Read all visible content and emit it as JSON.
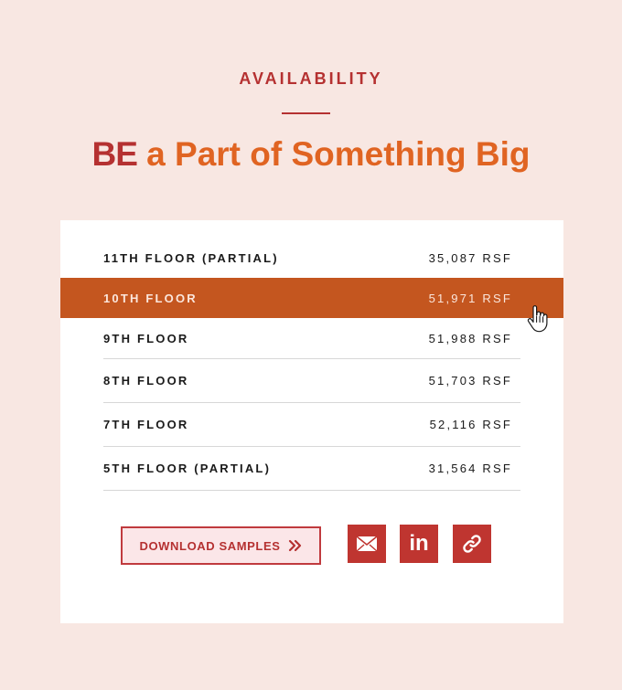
{
  "section": {
    "eyebrow": "AVAILABILITY",
    "headline_strong": "BE",
    "headline_rest": " a Part of Something Big"
  },
  "floors": [
    {
      "name": "11TH FLOOR (PARTIAL)",
      "area": "35,087 RSF",
      "active": false
    },
    {
      "name": "10TH FLOOR",
      "area": "51,971 RSF",
      "active": true
    },
    {
      "name": "9TH FLOOR",
      "area": "51,988 RSF",
      "active": false
    },
    {
      "name": "8TH FLOOR",
      "area": "51,703 RSF",
      "active": false
    },
    {
      "name": "7TH FLOOR",
      "area": "52,116 RSF",
      "active": false
    },
    {
      "name": "5TH FLOOR (PARTIAL)",
      "area": "31,564 RSF",
      "active": false
    }
  ],
  "actions": {
    "download_label": "DOWNLOAD SAMPLES",
    "share_icons": [
      "envelope-icon",
      "linkedin-icon",
      "link-icon"
    ]
  },
  "colors": {
    "background": "#f8e7e2",
    "accent_red": "#b53131",
    "accent_orange": "#e06422",
    "active_row": "#c4561f"
  }
}
